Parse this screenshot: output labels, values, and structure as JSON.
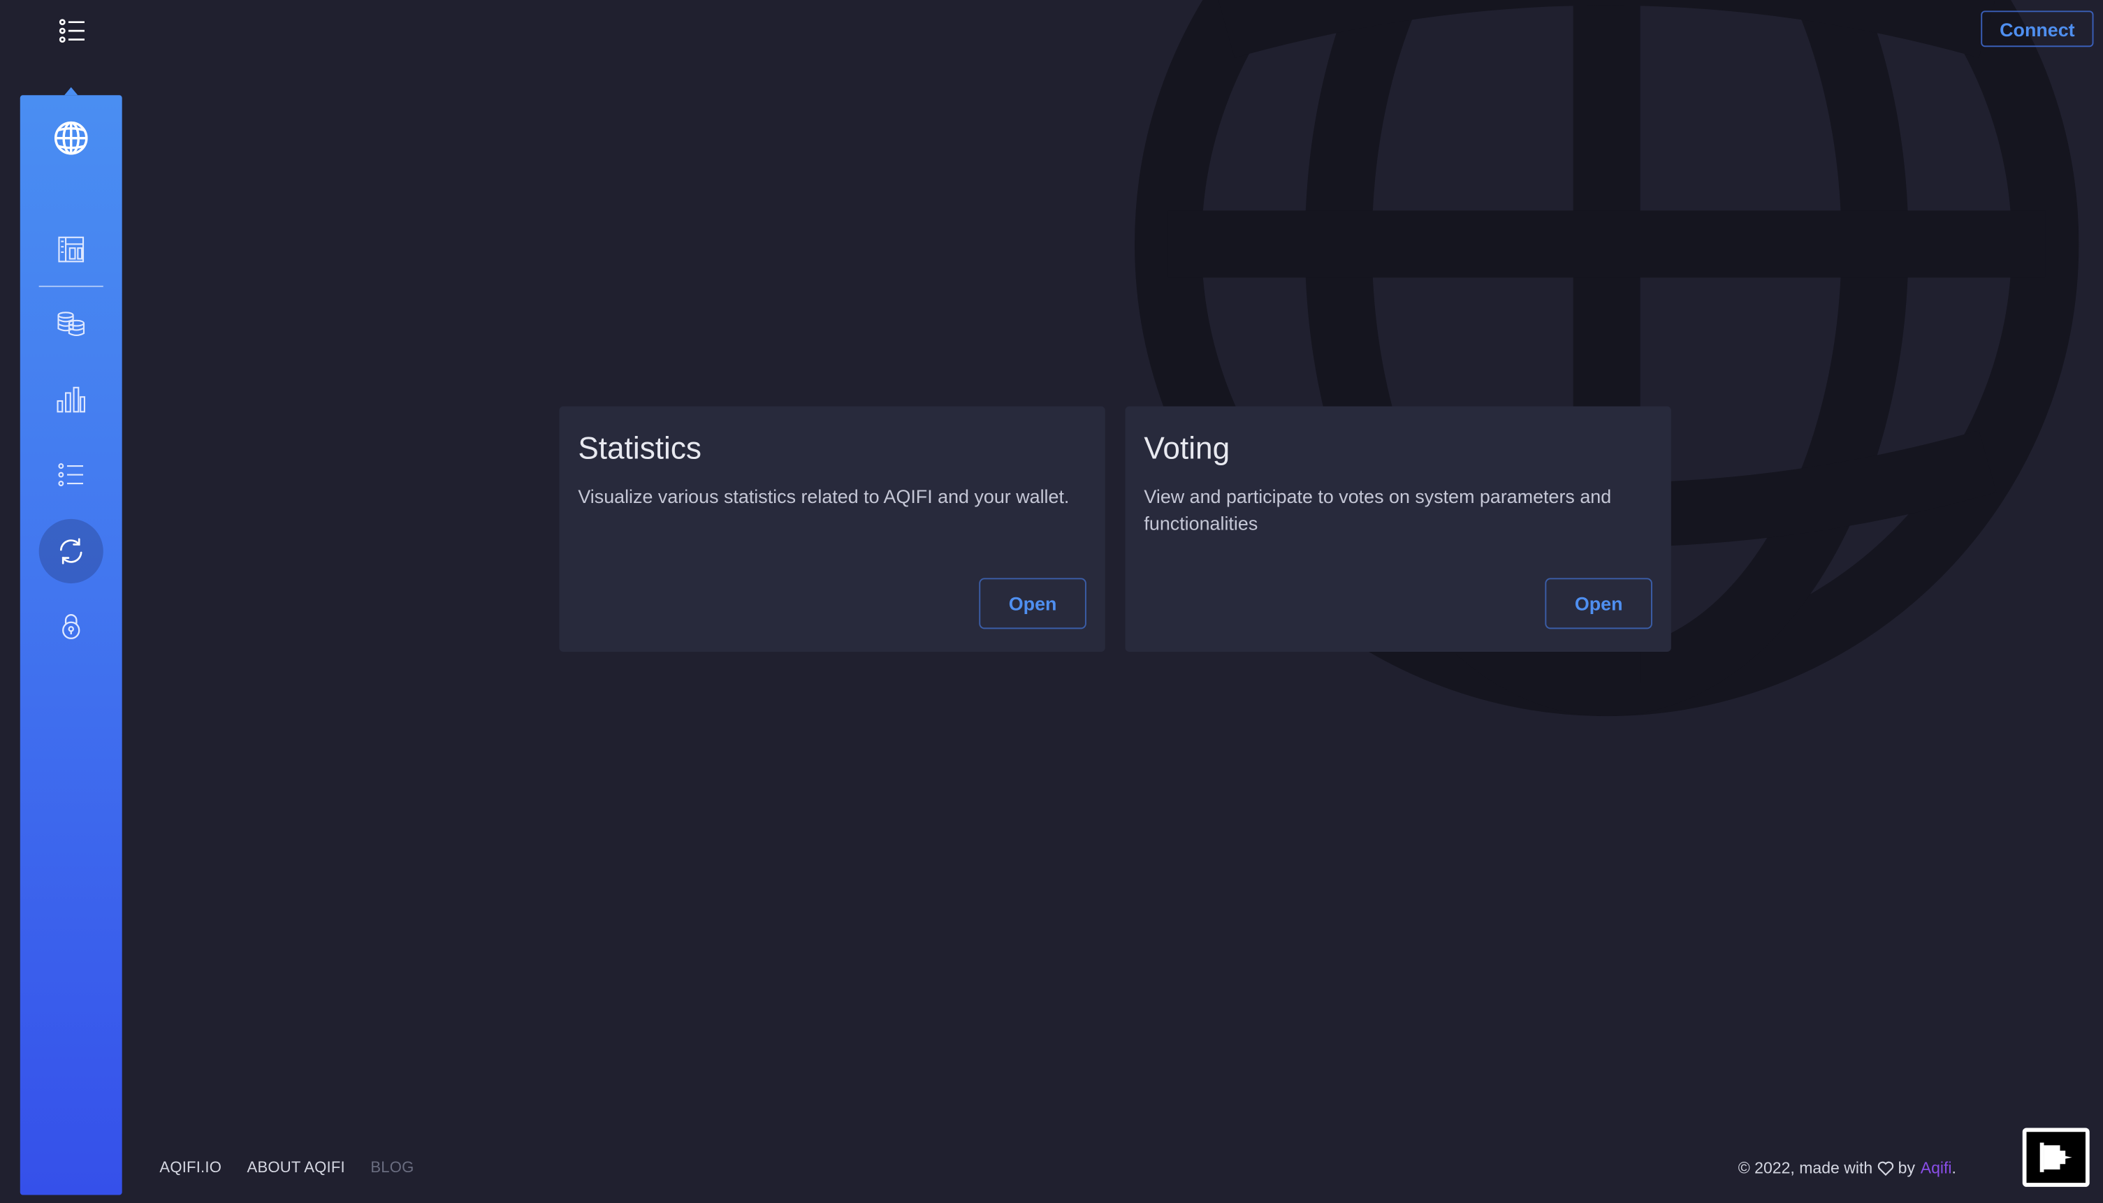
{
  "header": {
    "connect_label": "Connect"
  },
  "sidebar": {
    "items": [
      {
        "icon": "globe-icon"
      },
      {
        "icon": "dashboard-icon"
      },
      {
        "icon": "coins-icon"
      },
      {
        "icon": "bar-chart-icon"
      },
      {
        "icon": "list-icon"
      },
      {
        "icon": "refresh-icon",
        "active": true
      },
      {
        "icon": "lock-icon"
      }
    ]
  },
  "cards": [
    {
      "title": "Statistics",
      "description": "Visualize various statistics related to AQIFI and your wallet.",
      "button": "Open"
    },
    {
      "title": "Voting",
      "description": "View and participate to votes on system parameters and functionalities",
      "button": "Open"
    }
  ],
  "footer": {
    "links": [
      "AQIFI.IO",
      "ABOUT AQIFI",
      "BLOG"
    ],
    "copyright_prefix": "© 2022, made with",
    "copyright_by": "by",
    "brand": "Aqifi",
    "copyright_suffix": "."
  },
  "colors": {
    "background": "#20202f",
    "card": "#282a3c",
    "accent": "#4f8ff0",
    "sidebar_top": "#4a8ef2",
    "sidebar_bottom": "#3550ea",
    "brand": "#8a4ee8"
  }
}
